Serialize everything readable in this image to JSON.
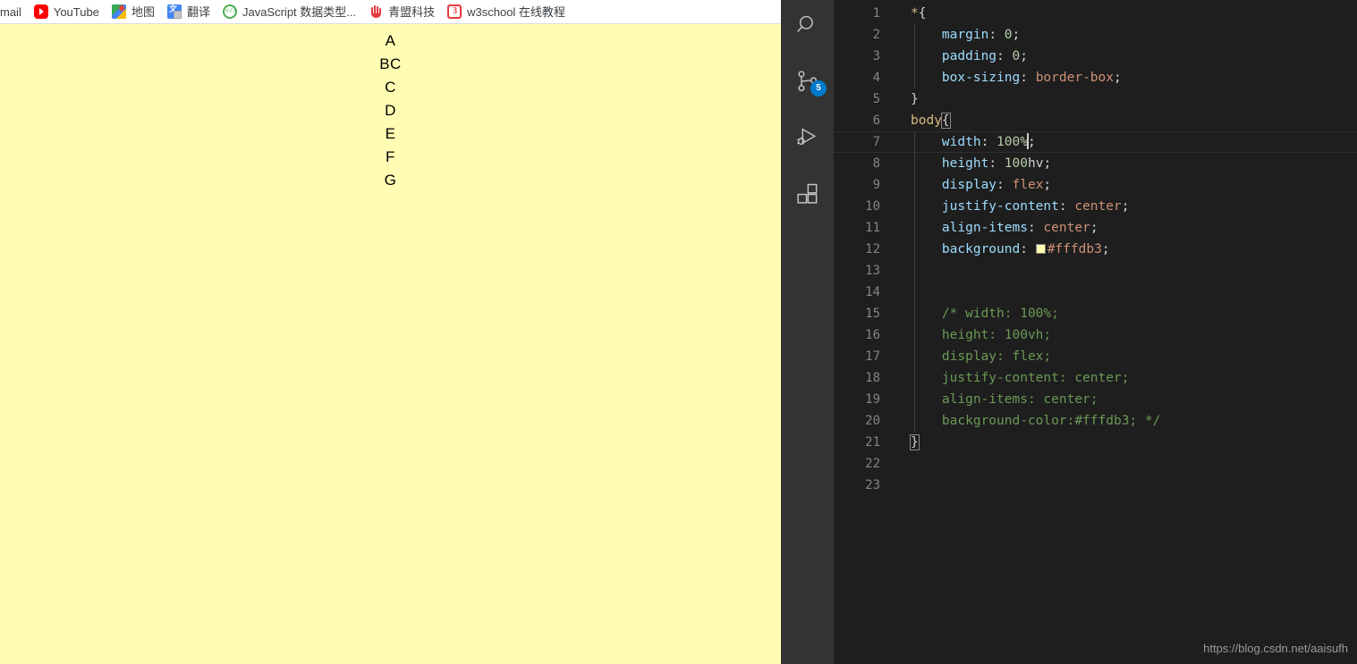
{
  "browser": {
    "bookmarks": [
      {
        "label": "mail",
        "icon": "mail-icon",
        "icon_class": "ic-none"
      },
      {
        "label": "YouTube",
        "icon": "youtube-icon",
        "icon_class": "ic-youtube"
      },
      {
        "label": "地图",
        "icon": "google-maps-icon",
        "icon_class": "ic-maps"
      },
      {
        "label": "翻译",
        "icon": "google-translate-icon",
        "icon_class": "ic-translate"
      },
      {
        "label": "JavaScript 数据类型...",
        "icon": "javascript-tutorial-icon",
        "icon_class": "ic-js"
      },
      {
        "label": "青盟科技",
        "icon": "qingmeng-hand-icon",
        "icon_class": "ic-hand"
      },
      {
        "label": "w3school 在线教程",
        "icon": "w3school-icon",
        "icon_class": "ic-w3"
      }
    ],
    "page": {
      "background_color": "#fffdb3",
      "letters": [
        "A",
        "BC",
        "C",
        "D",
        "E",
        "F",
        "G"
      ]
    }
  },
  "vscode": {
    "activity_bar": {
      "background_color": "#333333",
      "items": [
        {
          "name": "search-icon",
          "badge": null
        },
        {
          "name": "source-control-icon",
          "badge": "5"
        },
        {
          "name": "run-and-debug-icon",
          "badge": null
        },
        {
          "name": "extensions-icon",
          "badge": null
        }
      ],
      "badge_color": "#007acc"
    },
    "editor": {
      "background_color": "#1e1e1e",
      "active_line": 7,
      "color_swatch": "#fffdb3",
      "lines": [
        {
          "n": "1",
          "text": "*{"
        },
        {
          "n": "2",
          "text": "    margin: 0;"
        },
        {
          "n": "3",
          "text": "    padding: 0;"
        },
        {
          "n": "4",
          "text": "    box-sizing: border-box;"
        },
        {
          "n": "5",
          "text": "}"
        },
        {
          "n": "6",
          "text": "body{"
        },
        {
          "n": "7",
          "text": "    width: 100%;"
        },
        {
          "n": "8",
          "text": "    height: 100hv;"
        },
        {
          "n": "9",
          "text": "    display: flex;"
        },
        {
          "n": "10",
          "text": "    justify-content: center;"
        },
        {
          "n": "11",
          "text": "    align-items: center;"
        },
        {
          "n": "12",
          "text": "    background: #fffdb3;"
        },
        {
          "n": "13",
          "text": ""
        },
        {
          "n": "14",
          "text": ""
        },
        {
          "n": "15",
          "text": "    /* width: 100%;"
        },
        {
          "n": "16",
          "text": "    height: 100vh;"
        },
        {
          "n": "17",
          "text": "    display: flex;"
        },
        {
          "n": "18",
          "text": "    justify-content: center;"
        },
        {
          "n": "19",
          "text": "    align-items: center;"
        },
        {
          "n": "20",
          "text": "    background-color:#fffdb3; */"
        },
        {
          "n": "21",
          "text": "}"
        },
        {
          "n": "22",
          "text": ""
        },
        {
          "n": "23",
          "text": ""
        }
      ]
    },
    "watermark": "https://blog.csdn.net/aaisufh"
  }
}
